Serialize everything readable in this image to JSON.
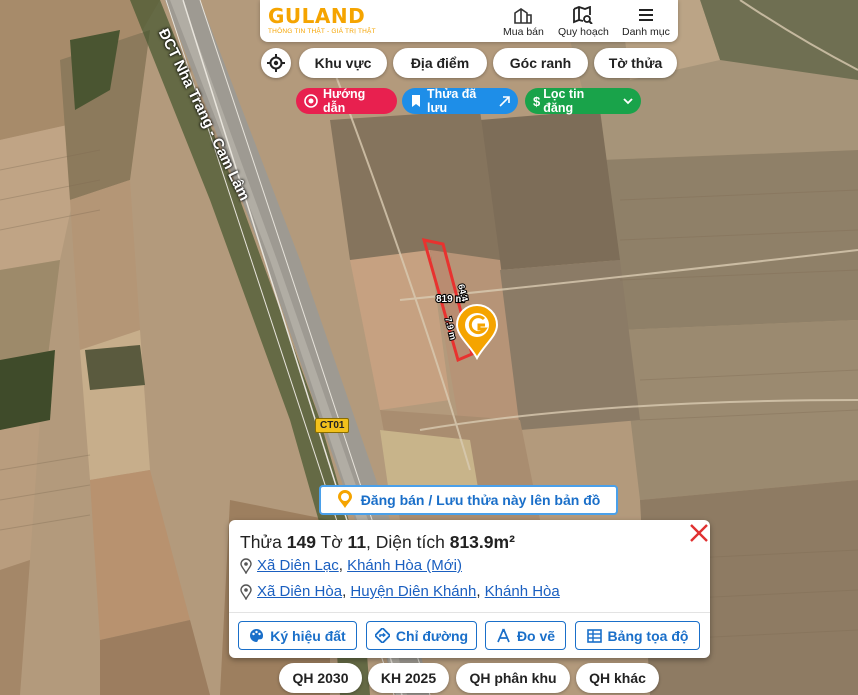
{
  "header": {
    "logo_text": "GULAND",
    "logo_tagline": "THÔNG TIN THẬT - GIÁ TRỊ THẬT",
    "nav": [
      {
        "label": "Mua bán",
        "icon": "building-icon"
      },
      {
        "label": "Quy hoạch",
        "icon": "map-search-icon"
      },
      {
        "label": "Danh mục",
        "icon": "menu-icon"
      }
    ]
  },
  "filters": {
    "chips": [
      "Khu vực",
      "Địa điểm",
      "Góc ranh",
      "Tờ thửa"
    ],
    "guide_label": "Hướng dẫn",
    "saved_label": "Thửa đã lưu",
    "listing_filter_label": "Lọc tin đăng"
  },
  "map": {
    "road_name": "ĐCT Nha Trang - Cam Lâm",
    "road_shield": "CT01",
    "parcel_area_label": "819 m²",
    "parcel_side_a": "7.9 m",
    "parcel_side_b": "64.4",
    "colors": {
      "parcel_outline": "#e8322f",
      "marker": "#f5a400",
      "accent_blue": "#1a6fc9"
    }
  },
  "post_banner": {
    "label": "Đăng bán / Lưu thửa này lên bản đồ"
  },
  "card": {
    "title_prefix": "Thửa",
    "parcel_no": "149",
    "sheet_prefix": "Tờ",
    "sheet_no": "11",
    "area_prefix": ", Diện tích",
    "area": "813.9m²",
    "address_new": {
      "commune": "Xã Diên Lạc",
      "province": "Khánh Hòa (Mới)"
    },
    "address_old": {
      "commune": "Xã Diên Hòa",
      "district": "Huyện Diên Khánh",
      "province": "Khánh Hòa"
    },
    "actions": [
      {
        "label": "Ký hiệu đất",
        "icon": "palette-icon"
      },
      {
        "label": "Chỉ đường",
        "icon": "directions-icon"
      },
      {
        "label": "Đo vẽ",
        "icon": "measure-icon"
      },
      {
        "label": "Bảng tọa độ",
        "icon": "table-icon"
      }
    ]
  },
  "bottom_tabs": [
    "QH 2030",
    "KH 2025",
    "QH phân khu",
    "QH khác"
  ]
}
